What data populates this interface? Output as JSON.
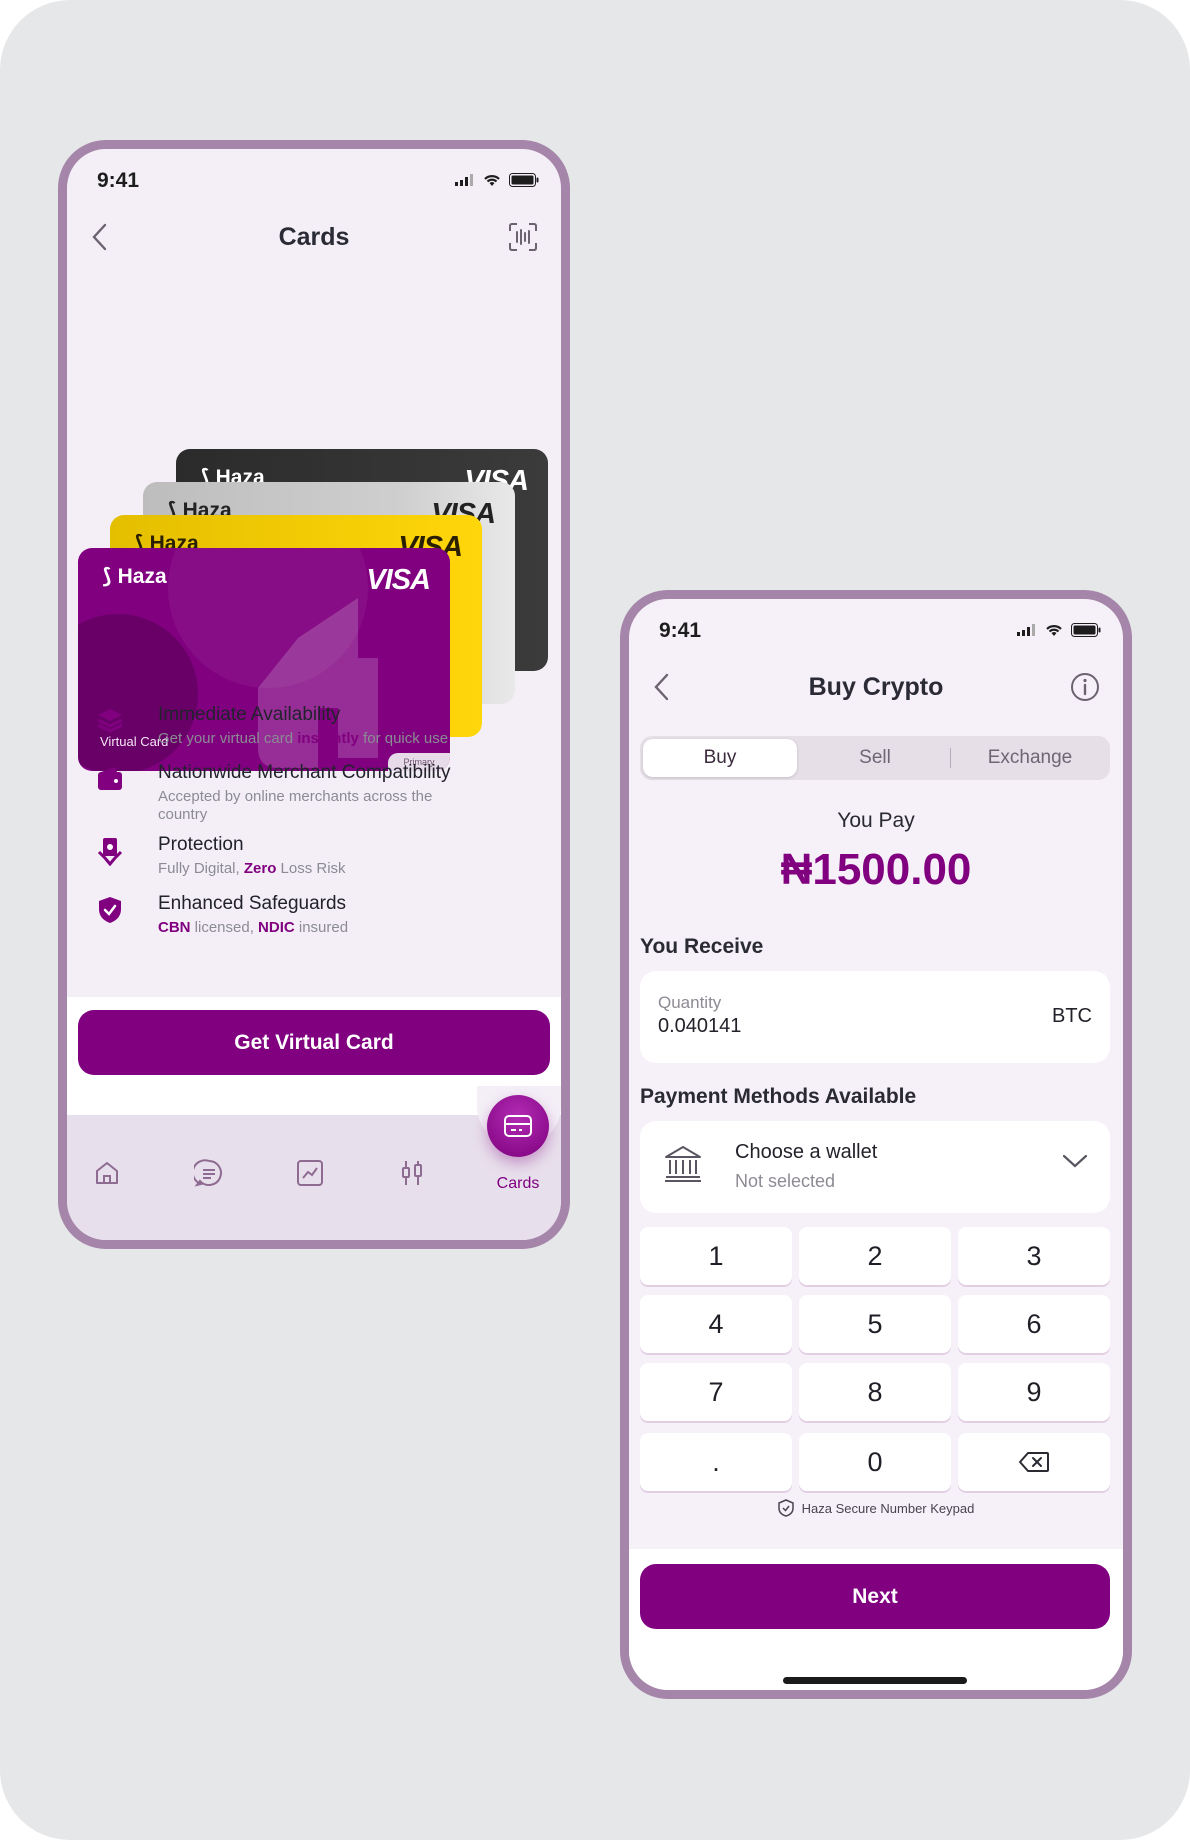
{
  "screen_cards": {
    "status_time": "9:41",
    "title": "Cards",
    "cards": [
      {
        "brand": "Haza",
        "network": "VISA",
        "color": "#2b2b2b"
      },
      {
        "brand": "Haza",
        "network": "VISA",
        "color": "#c4c4c4"
      },
      {
        "brand": "Haza",
        "network": "VISA",
        "color": "#ffd60a"
      },
      {
        "brand": "Haza",
        "network": "VISA",
        "color": "#800080",
        "type_label": "Virtual Card",
        "tag": "Primary"
      }
    ],
    "features": [
      {
        "icon": "layers-icon",
        "title": "Immediate Availability",
        "desc_pre": "Get your virtual card ",
        "desc_bold": "instantly",
        "desc_post": " for quick use"
      },
      {
        "icon": "wallet-icon",
        "title": "Nationwide Merchant Compatibility",
        "desc": "Accepted by online merchants across the country"
      },
      {
        "icon": "money-hand-icon",
        "title": "Protection",
        "desc_pre": "Fully Digital, ",
        "desc_bold": "Zero",
        "desc_post": " Loss Risk"
      },
      {
        "icon": "shield-check-icon",
        "title": "Enhanced Safeguards",
        "desc_bold1": "CBN",
        "desc_mid1": " licensed, ",
        "desc_bold2": "NDIC",
        "desc_mid2": " insured"
      }
    ],
    "cta": "Get Virtual Card",
    "tabbar": {
      "active_label": "Cards",
      "tabs": [
        "home-icon",
        "chat-icon",
        "chart-icon",
        "candles-icon",
        "card-icon"
      ]
    }
  },
  "screen_buy": {
    "status_time": "9:41",
    "title": "Buy Crypto",
    "segments": [
      "Buy",
      "Sell",
      "Exchange"
    ],
    "selected_segment": "Buy",
    "you_pay_label": "You Pay",
    "amount": "₦1500.00",
    "you_receive_label": "You Receive",
    "quantity_label": "Quantity",
    "quantity_value": "0.040141",
    "currency": "BTC",
    "payment_label": "Payment Methods Available",
    "wallet_title": "Choose a wallet",
    "wallet_sub": "Not selected",
    "keys": [
      "1",
      "2",
      "3",
      "4",
      "5",
      "6",
      "7",
      "8",
      "9",
      ".",
      "0",
      "⌫"
    ],
    "secure_text": "Haza Secure Number Keypad",
    "cta": "Next"
  },
  "colors": {
    "brand": "#800080",
    "frame": "#a585a9",
    "background": "#e6e7e9"
  }
}
